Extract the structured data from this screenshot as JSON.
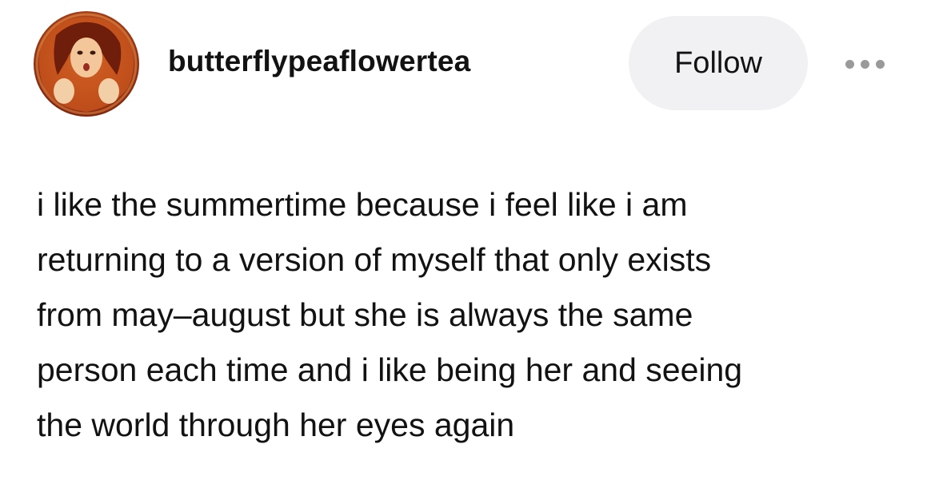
{
  "post": {
    "username": "butterflypeaflowertea",
    "follow_label": "Follow",
    "more_icon": "more-options-icon",
    "body_lines": [
      "i like the summertime because i feel like i am",
      "returning to a version of myself that only exists",
      "from may–august but she is always the same",
      "person each time and i like being her and seeing",
      "the world through her eyes again"
    ]
  },
  "colors": {
    "text": "#121212",
    "follow_bg": "#f1f1f3",
    "dots": "#9a9a9a"
  }
}
